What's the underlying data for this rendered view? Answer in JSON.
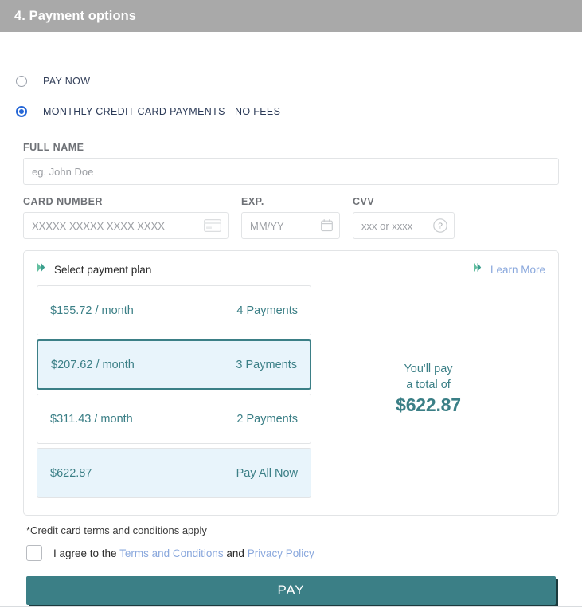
{
  "header": {
    "title": "4. Payment options"
  },
  "payment_method": {
    "options": [
      {
        "label": "PAY NOW",
        "selected": false
      },
      {
        "label": "MONTHLY CREDIT CARD PAYMENTS - NO FEES",
        "selected": true
      }
    ]
  },
  "form": {
    "full_name": {
      "label": "FULL NAME",
      "placeholder": "eg. John Doe",
      "value": ""
    },
    "card_number": {
      "label": "CARD NUMBER",
      "placeholder": "XXXXX XXXXX XXXX XXXX",
      "value": "",
      "icon": "credit-card-icon"
    },
    "exp": {
      "label": "EXP.",
      "placeholder": "MM/YY",
      "value": "",
      "icon": "calendar-icon"
    },
    "cvv": {
      "label": "CVV",
      "placeholder": "xxx or xxxx",
      "value": "",
      "icon": "help-circle-icon"
    }
  },
  "plan_card": {
    "title": "Select payment plan",
    "learn_more": "Learn More",
    "icon": "chevron-logo-icon",
    "options": [
      {
        "amount": "$155.72 / month",
        "count": "4 Payments",
        "selected": false,
        "pay_all": false
      },
      {
        "amount": "$207.62 / month",
        "count": "3 Payments",
        "selected": true,
        "pay_all": false
      },
      {
        "amount": "$311.43 / month",
        "count": "2 Payments",
        "selected": false,
        "pay_all": false
      },
      {
        "amount": "$622.87",
        "count": "Pay All Now",
        "selected": false,
        "pay_all": true
      }
    ],
    "total": {
      "line1": "You'll pay",
      "line2": "a total of",
      "amount": "$622.87"
    }
  },
  "terms": {
    "note": "*Credit card terms and conditions apply",
    "agree_prefix": "I agree to the ",
    "terms_link": "Terms and Conditions",
    "agree_middle": " and ",
    "privacy_link": "Privacy Policy",
    "checked": false
  },
  "pay_button": {
    "label": "PAY"
  },
  "colors": {
    "header_bar": "#a9a9a9",
    "teal": "#3b7f86",
    "link_blue": "#8aa8dd",
    "radio_blue": "#2667d6",
    "selected_row_bg": "#e8f4fb",
    "button_shadow": "#1b3a3d"
  }
}
